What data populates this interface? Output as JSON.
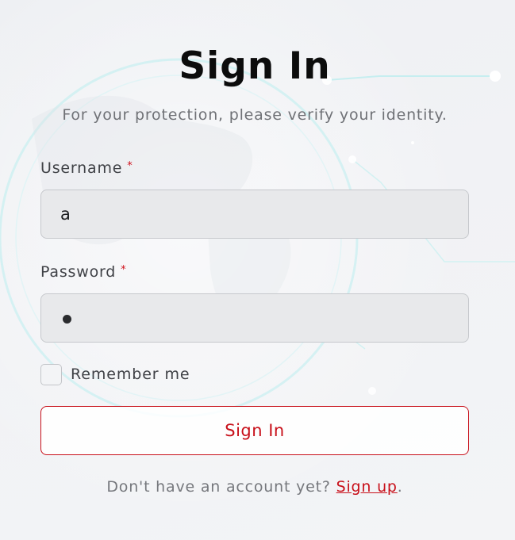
{
  "form": {
    "title": "Sign In",
    "subtitle": "For your protection, please verify your identity.",
    "username": {
      "label": "Username",
      "required_mark": "*",
      "value": "a"
    },
    "password": {
      "label": "Password",
      "required_mark": "*",
      "masked_value": "•"
    },
    "remember_me": {
      "label": "Remember me",
      "checked": false
    },
    "submit_label": "Sign In",
    "footer": {
      "prompt": "Don't have an account yet?",
      "link_label": "Sign up",
      "trailing": "."
    }
  },
  "colors": {
    "accent": "#c8101a",
    "title": "#0c0c0c",
    "muted_text": "#6f7176",
    "field_bg": "#e8e9eb",
    "background": "#f1f2f5"
  }
}
